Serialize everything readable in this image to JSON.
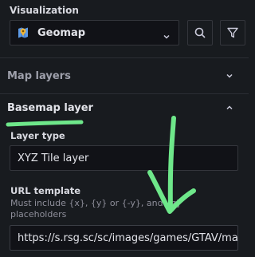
{
  "visualization": {
    "label": "Visualization",
    "selected": "Geomap",
    "icons": {
      "viz": "map-pin-icon",
      "search": "search-icon",
      "filter": "filter-icon"
    }
  },
  "map_layers": {
    "label": "Map layers",
    "chevron": "chevron-down-icon"
  },
  "basemap": {
    "label": "Basemap layer",
    "chevron": "chevron-up-icon",
    "layer_type": {
      "label": "Layer type",
      "value": "XYZ Tile layer"
    },
    "url_template": {
      "label": "URL template",
      "hint": "Must include {x}, {y} or {-y}, and {z} placeholders",
      "value": "https://s.rsg.sc/sc/images/games/GTAV/map/"
    }
  },
  "colors": {
    "background": "#181b1f",
    "annotation": "#6ee78a"
  }
}
